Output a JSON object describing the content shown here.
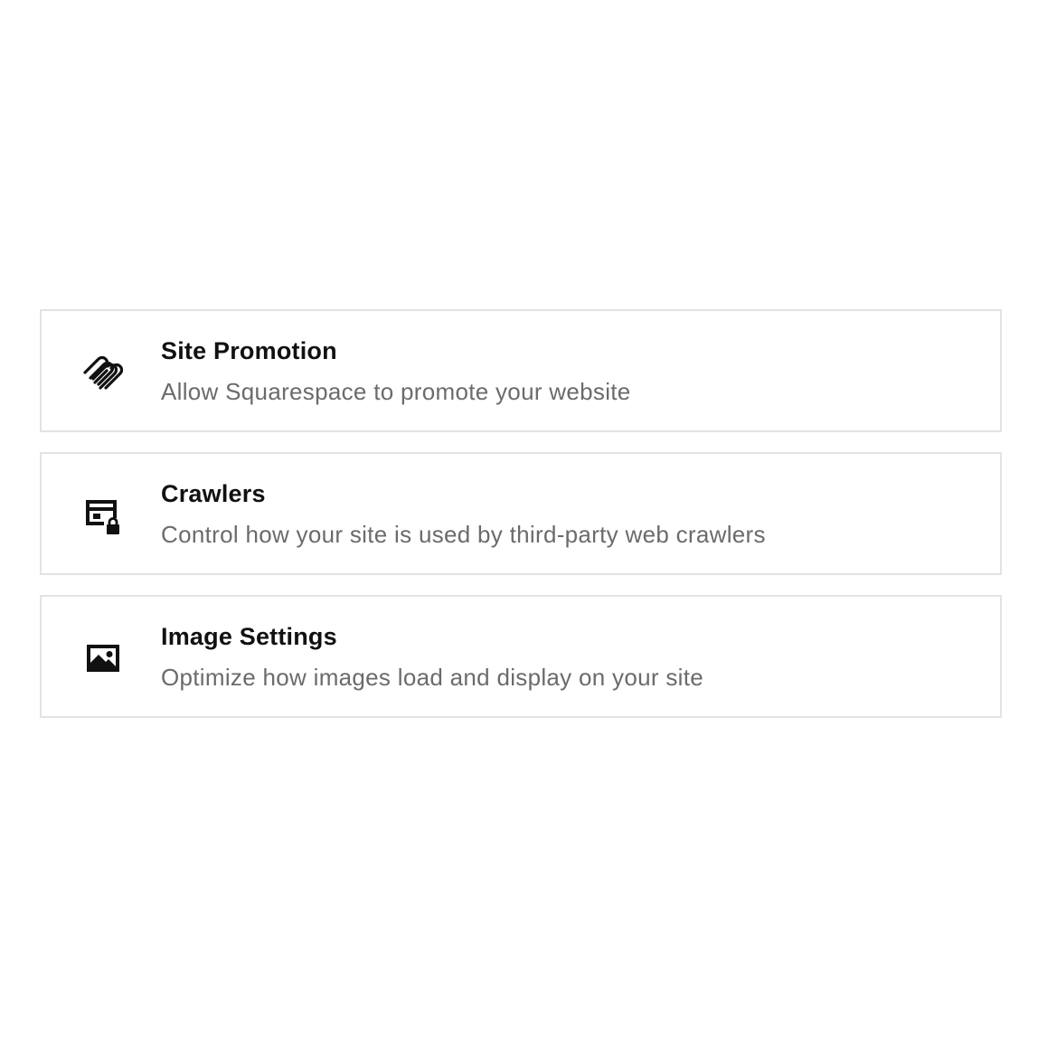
{
  "settings": {
    "items": [
      {
        "icon": "squarespace-logo-icon",
        "title": "Site Promotion",
        "description": "Allow Squarespace to promote your website"
      },
      {
        "icon": "crawler-lock-icon",
        "title": "Crawlers",
        "description": "Control how your site is used by third-party web crawlers"
      },
      {
        "icon": "image-icon",
        "title": "Image Settings",
        "description": "Optimize how images load and display on your site"
      }
    ]
  },
  "colors": {
    "title": "#111111",
    "description": "#6b6b6b",
    "border": "#e3e3e3",
    "background": "#ffffff"
  }
}
